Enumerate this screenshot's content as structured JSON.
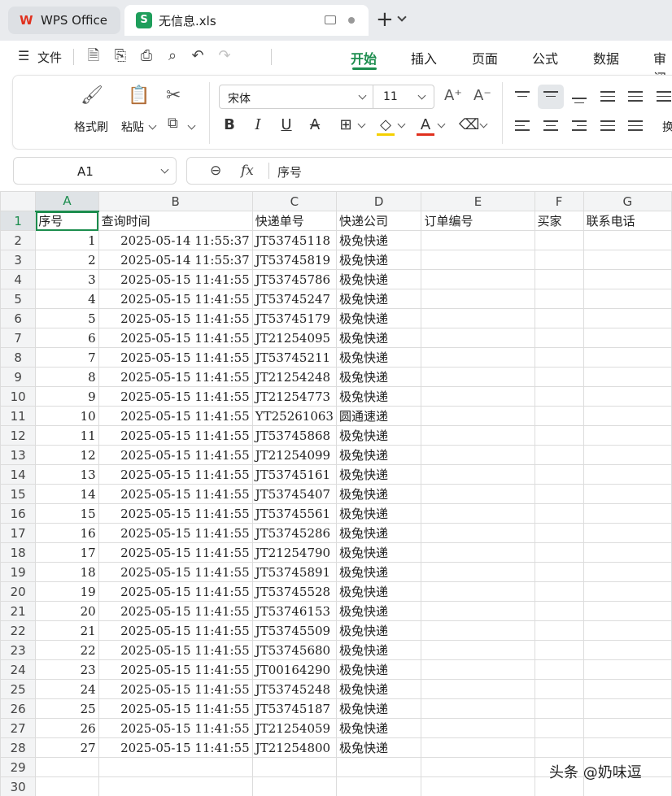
{
  "tabs": {
    "app_name": "WPS Office",
    "file_name": "无信息.xls",
    "file_icon_letter": "S"
  },
  "menu": {
    "file_label": "文件",
    "ribbon_tabs": [
      "开始",
      "插入",
      "页面",
      "公式",
      "数据",
      "审阅"
    ],
    "active_tab": "开始"
  },
  "ribbon": {
    "format_painter": "格式刷",
    "paste": "粘贴",
    "font_name": "宋体",
    "font_size": "11",
    "wrap_label": "换"
  },
  "formula_bar": {
    "cell_ref": "A1",
    "fx": "fx",
    "value": "序号"
  },
  "sheet": {
    "columns": [
      "A",
      "B",
      "C",
      "D",
      "E",
      "F",
      "G"
    ],
    "header_row": [
      "序号",
      "查询时间",
      "快递单号",
      "快递公司",
      "订单编号",
      "买家",
      "联系电话"
    ],
    "rows": [
      [
        "1",
        "2025-05-14 11:55:37",
        "JT53745118",
        "极兔快递"
      ],
      [
        "2",
        "2025-05-14 11:55:37",
        "JT53745819",
        "极兔快递"
      ],
      [
        "3",
        "2025-05-15 11:41:55",
        "JT53745786",
        "极兔快递"
      ],
      [
        "4",
        "2025-05-15 11:41:55",
        "JT53745247",
        "极兔快递"
      ],
      [
        "5",
        "2025-05-15 11:41:55",
        "JT53745179",
        "极兔快递"
      ],
      [
        "6",
        "2025-05-15 11:41:55",
        "JT21254095",
        "极兔快递"
      ],
      [
        "7",
        "2025-05-15 11:41:55",
        "JT53745211",
        "极兔快递"
      ],
      [
        "8",
        "2025-05-15 11:41:55",
        "JT21254248",
        "极兔快递"
      ],
      [
        "9",
        "2025-05-15 11:41:55",
        "JT21254773",
        "极兔快递"
      ],
      [
        "10",
        "2025-05-15 11:41:55",
        "YT25261063",
        "圆通速递"
      ],
      [
        "11",
        "2025-05-15 11:41:55",
        "JT53745868",
        "极兔快递"
      ],
      [
        "12",
        "2025-05-15 11:41:55",
        "JT21254099",
        "极兔快递"
      ],
      [
        "13",
        "2025-05-15 11:41:55",
        "JT53745161",
        "极兔快递"
      ],
      [
        "14",
        "2025-05-15 11:41:55",
        "JT53745407",
        "极兔快递"
      ],
      [
        "15",
        "2025-05-15 11:41:55",
        "JT53745561",
        "极兔快递"
      ],
      [
        "16",
        "2025-05-15 11:41:55",
        "JT53745286",
        "极兔快递"
      ],
      [
        "17",
        "2025-05-15 11:41:55",
        "JT21254790",
        "极兔快递"
      ],
      [
        "18",
        "2025-05-15 11:41:55",
        "JT53745891",
        "极兔快递"
      ],
      [
        "19",
        "2025-05-15 11:41:55",
        "JT53745528",
        "极兔快递"
      ],
      [
        "20",
        "2025-05-15 11:41:55",
        "JT53746153",
        "极兔快递"
      ],
      [
        "21",
        "2025-05-15 11:41:55",
        "JT53745509",
        "极兔快递"
      ],
      [
        "22",
        "2025-05-15 11:41:55",
        "JT53745680",
        "极兔快递"
      ],
      [
        "23",
        "2025-05-15 11:41:55",
        "JT00164290",
        "极兔快递"
      ],
      [
        "24",
        "2025-05-15 11:41:55",
        "JT53745248",
        "极兔快递"
      ],
      [
        "25",
        "2025-05-15 11:41:55",
        "JT53745187",
        "极兔快递"
      ],
      [
        "26",
        "2025-05-15 11:41:55",
        "JT21254059",
        "极兔快递"
      ],
      [
        "27",
        "2025-05-15 11:41:55",
        "JT21254800",
        "极兔快递"
      ]
    ],
    "row_numbers": [
      "1",
      "2",
      "3",
      "4",
      "5",
      "6",
      "7",
      "8",
      "9",
      "10",
      "11",
      "12",
      "13",
      "14",
      "15",
      "16",
      "17",
      "18",
      "19",
      "20",
      "21",
      "22",
      "23",
      "24",
      "25",
      "26",
      "27",
      "28",
      "29",
      "30"
    ]
  },
  "watermark": "头条 @奶味逗",
  "colors": {
    "accent": "#1c8d4e",
    "wps_red": "#e0301e"
  }
}
